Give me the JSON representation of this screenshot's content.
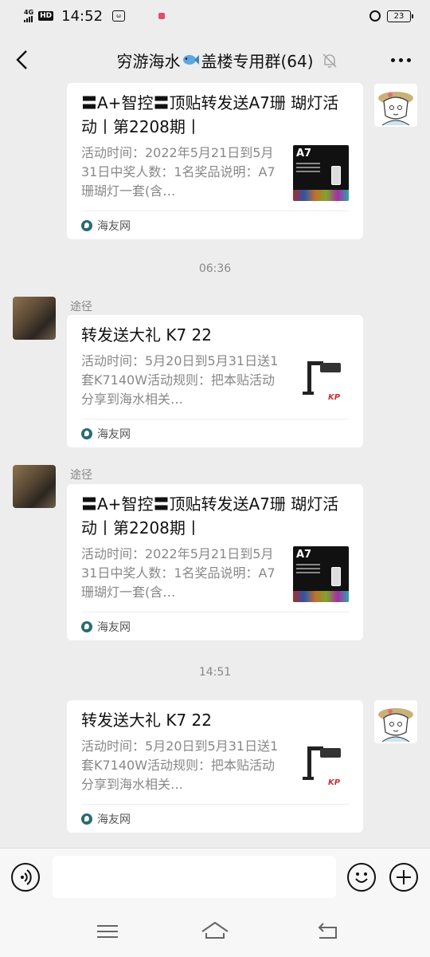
{
  "status_bar": {
    "network": "4G",
    "hd": "HD",
    "time": "14:52",
    "app_badge": "ω",
    "battery": "23"
  },
  "nav": {
    "title_prefix": "穷游海水",
    "title_suffix": "盖楼专用群(64)"
  },
  "messages": [
    {
      "sender": "",
      "side": "right",
      "card": {
        "title": "〓A+智控〓顶贴转发送A7珊 瑚灯活动丨第2208期丨",
        "desc": "活动时间：2022年5月21日到5月31日中奖人数：1名奖品说明：A7珊瑚灯一套(含…",
        "source": "海友网",
        "thumb": "a7"
      }
    },
    {
      "sender": "途径",
      "side": "left",
      "card": {
        "title": "转发送大礼 K7 22",
        "desc": "活动时间：5月20日到5月31日送1套K7140W活动规则：把本贴活动分享到海水相关…",
        "source": "海友网",
        "thumb": "k7"
      }
    },
    {
      "sender": "途径",
      "side": "left",
      "card": {
        "title": "〓A+智控〓顶贴转发送A7珊 瑚灯活动丨第2208期丨",
        "desc": "活动时间：2022年5月21日到5月31日中奖人数：1名奖品说明：A7珊瑚灯一套(含…",
        "source": "海友网",
        "thumb": "a7"
      }
    },
    {
      "sender": "",
      "side": "right",
      "card": {
        "title": "转发送大礼 K7 22",
        "desc": "活动时间：5月20日到5月31日送1套K7140W活动规则：把本贴活动分享到海水相关…",
        "source": "海友网",
        "thumb": "k7"
      }
    }
  ],
  "timestamps": [
    "06:36",
    "14:51"
  ],
  "thumb_label": "A7",
  "input": {
    "placeholder": ""
  }
}
